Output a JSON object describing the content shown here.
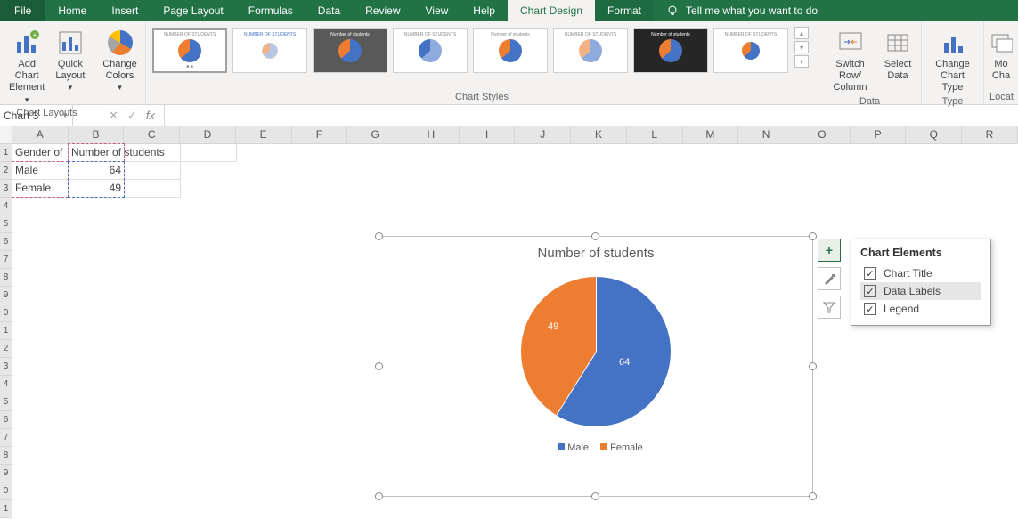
{
  "ribbon": {
    "tabs": {
      "file": "File",
      "home": "Home",
      "insert": "Insert",
      "page_layout": "Page Layout",
      "formulas": "Formulas",
      "data": "Data",
      "review": "Review",
      "view": "View",
      "help": "Help",
      "chart_design": "Chart Design",
      "format": "Format"
    },
    "tellme": "Tell me what you want to do",
    "groups": {
      "chart_layouts": "Chart Layouts",
      "chart_styles": "Chart Styles",
      "data": "Data",
      "type": "Type",
      "location": "Locat"
    },
    "buttons": {
      "add_chart_element": "Add Chart\nElement",
      "quick_layout": "Quick\nLayout",
      "change_colors": "Change\nColors",
      "switch_row_col": "Switch Row/\nColumn",
      "select_data": "Select\nData",
      "change_chart_type": "Change\nChart Type",
      "move_chart": "Mo\nCha"
    }
  },
  "name_box": "Chart 3",
  "columns": [
    "A",
    "B",
    "C",
    "D",
    "E",
    "F",
    "G",
    "H",
    "I",
    "J",
    "K",
    "L",
    "M",
    "N",
    "O",
    "P",
    "Q",
    "R"
  ],
  "row_numbers": [
    "1",
    "2",
    "3",
    "4",
    "5",
    "6",
    "7",
    "8",
    "9",
    "0",
    "1",
    "2",
    "3",
    "4",
    "5",
    "6",
    "7",
    "8",
    "9",
    "0",
    "1"
  ],
  "cells": {
    "A1": "Gender of",
    "B1": "Number of students",
    "A2": "Male",
    "B2": "64",
    "A3": "Female",
    "B3": "49"
  },
  "chart": {
    "title": "Number of students",
    "label_male": "64",
    "label_female": "49",
    "legend_male": "Male",
    "legend_female": "Female"
  },
  "side_buttons": {
    "plus": "+",
    "brush": "",
    "filter": ""
  },
  "flyout": {
    "title": "Chart Elements",
    "items": {
      "chart_title": "Chart Title",
      "data_labels": "Data Labels",
      "legend": "Legend"
    }
  },
  "chart_data": {
    "type": "pie",
    "title": "Number of students",
    "categories": [
      "Male",
      "Female"
    ],
    "values": [
      64,
      49
    ],
    "colors": [
      "#4472C4",
      "#ED7D31"
    ],
    "data_labels": true,
    "legend_position": "bottom"
  }
}
